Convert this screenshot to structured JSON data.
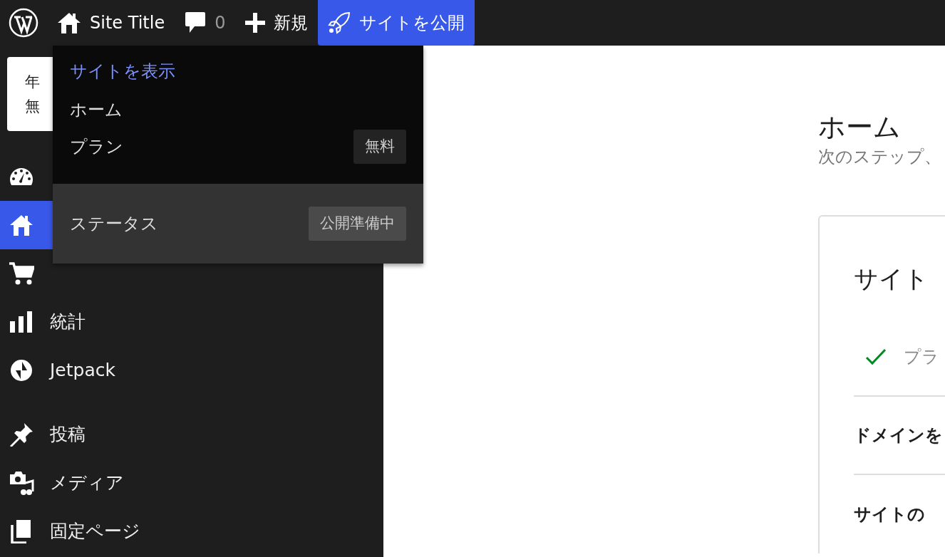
{
  "topbar": {
    "site_title": "Site Title",
    "comments_count": "0",
    "new_label": "新規",
    "launch_label": "サイトを公開"
  },
  "dropdown": {
    "view_site": "サイトを表示",
    "items": [
      {
        "label": "ホーム"
      },
      {
        "label": "プラン",
        "badge": "無料"
      }
    ],
    "status": {
      "label": "ステータス",
      "badge": "公開準備中"
    }
  },
  "notice_card": {
    "lines": [
      "年",
      "無"
    ]
  },
  "sidebar": {
    "items": [
      {
        "selected": false
      },
      {
        "selected": true
      },
      {
        "selected": false
      },
      {
        "label": "統計",
        "selected": false
      },
      {
        "label": "Jetpack",
        "selected": false
      },
      {
        "label": "投稿",
        "selected": false
      },
      {
        "label": "メディア",
        "selected": false
      },
      {
        "label": "固定ページ",
        "selected": false
      }
    ]
  },
  "main": {
    "title": "ホーム",
    "subtitle": "次のステップ、",
    "card": {
      "title": "サイト",
      "tasks": [
        {
          "label": "プラ",
          "done": true
        },
        {
          "label": "ドメインを",
          "done": false
        },
        {
          "label": "サイトの",
          "done": false
        }
      ]
    }
  }
}
